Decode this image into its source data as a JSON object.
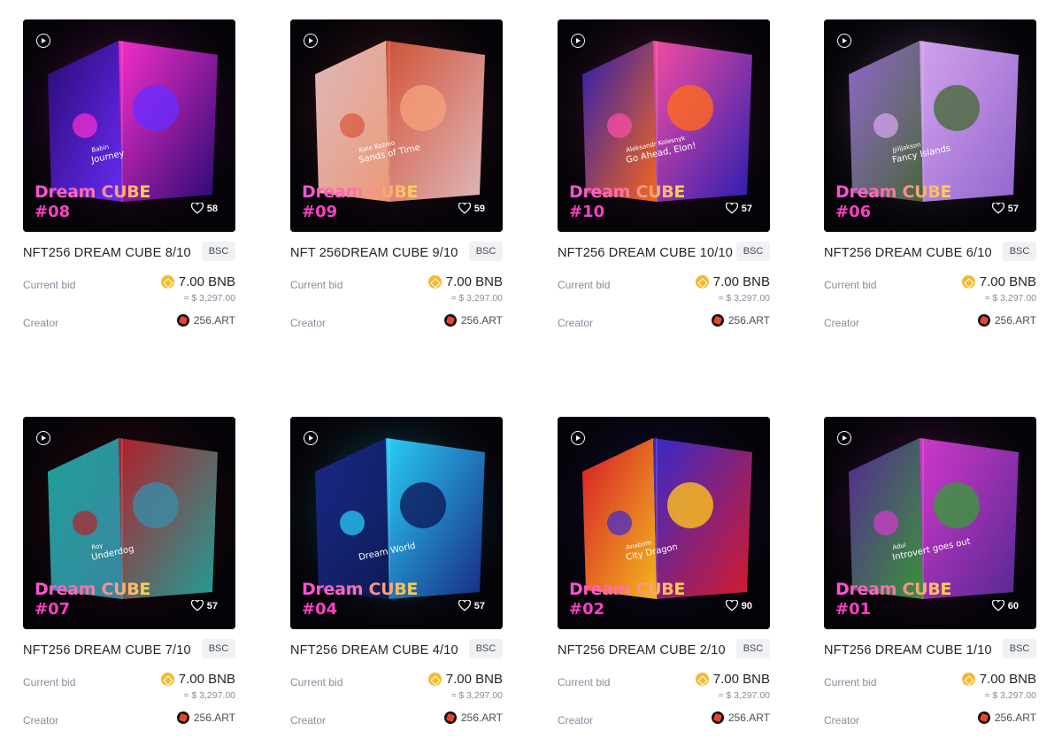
{
  "currency_symbol": "BNB",
  "cards": [
    {
      "series_title": "Dream CUBE",
      "number": "#08",
      "likes": "58",
      "name": "NFT256 DREAM CUBE 8/10",
      "chain": "BSC",
      "bid_label": "Current bid",
      "price": "7.00 BNB",
      "usd": "≈ $ 3,297.00",
      "creator_label": "Creator",
      "creator": "256.ART",
      "art_caption_1": "Babin",
      "art_caption_2": "Journey",
      "colors": [
        "#2a0b78",
        "#ff2fd1",
        "#6a2cff"
      ]
    },
    {
      "series_title": "Dream CUBE",
      "number": "#09",
      "likes": "59",
      "name": "NFT 256DREAM CUBE 9/10",
      "chain": "BSC",
      "bid_label": "Current bid",
      "price": "7.00 BNB",
      "usd": "≈ $ 3,297.00",
      "creator_label": "Creator",
      "creator": "256.ART",
      "art_caption_1": "Kate Kozmo",
      "art_caption_2": "Sands of Time",
      "colors": [
        "#e9c1c4",
        "#d8563a",
        "#f4a17e"
      ]
    },
    {
      "series_title": "Dream CUBE",
      "number": "#10",
      "likes": "57",
      "name": "NFT256 DREAM CUBE 10/10",
      "chain": "BSC",
      "bid_label": "Current bid",
      "price": "7.00 BNB",
      "usd": "≈ $ 3,297.00",
      "creator_label": "Creator",
      "creator": "256.ART",
      "art_caption_1": "Aleksandr Kolesnyk",
      "art_caption_2": "Go Ahead, Elon!",
      "colors": [
        "#2b1fb8",
        "#ff4fa8",
        "#ff6a1a"
      ]
    },
    {
      "series_title": "Dream CUBE",
      "number": "#06",
      "likes": "57",
      "name": "NFT256 DREAM CUBE 6/10",
      "chain": "BSC",
      "bid_label": "Current bid",
      "price": "7.00 BNB",
      "usd": "≈ $ 3,297.00",
      "creator_label": "Creator",
      "creator": "256.ART",
      "art_caption_1": "Jjiiljakson",
      "art_caption_2": "Fancy Islands",
      "colors": [
        "#9a6bd8",
        "#d9a8f4",
        "#4a6b3a"
      ]
    },
    {
      "series_title": "Dream CUBE",
      "number": "#07",
      "likes": "57",
      "name": "NFT256 DREAM CUBE 7/10",
      "chain": "BSC",
      "bid_label": "Current bid",
      "price": "7.00 BNB",
      "usd": "≈ $ 3,297.00",
      "creator_label": "Creator",
      "creator": "256.ART",
      "art_caption_1": "Roy",
      "art_caption_2": "Underdog",
      "colors": [
        "#1fa8a0",
        "#b8202a",
        "#3a8ca8"
      ]
    },
    {
      "series_title": "Dream CUBE",
      "number": "#04",
      "likes": "57",
      "name": "NFT256 DREAM CUBE 4/10",
      "chain": "BSC",
      "bid_label": "Current bid",
      "price": "7.00 BNB",
      "usd": "≈ $ 3,297.00",
      "creator_label": "Creator",
      "creator": "256.ART",
      "art_caption_1": "",
      "art_caption_2": "Dream World",
      "colors": [
        "#1a2a8a",
        "#2ad6ff",
        "#0e1a5a"
      ]
    },
    {
      "series_title": "Dream CUBE",
      "number": "#02",
      "likes": "90",
      "name": "NFT256 DREAM CUBE 2/10",
      "chain": "BSC",
      "bid_label": "Current bid",
      "price": "7.00 BNB",
      "usd": "≈ $ 3,297.00",
      "creator_label": "Creator",
      "creator": "256.ART",
      "art_caption_1": "Anabom",
      "art_caption_2": "City Dragon",
      "colors": [
        "#e01c2a",
        "#3a2ad0",
        "#ffc21a"
      ]
    },
    {
      "series_title": "Dream CUBE",
      "number": "#01",
      "likes": "60",
      "name": "NFT256 DREAM CUBE 1/10",
      "chain": "BSC",
      "bid_label": "Current bid",
      "price": "7.00 BNB",
      "usd": "≈ $ 3,297.00",
      "creator_label": "Creator",
      "creator": "256.ART",
      "art_caption_1": "Adui",
      "art_caption_2": "Introvert goes out",
      "colors": [
        "#5a2a9a",
        "#d83ad0",
        "#3a9a3a"
      ]
    }
  ]
}
